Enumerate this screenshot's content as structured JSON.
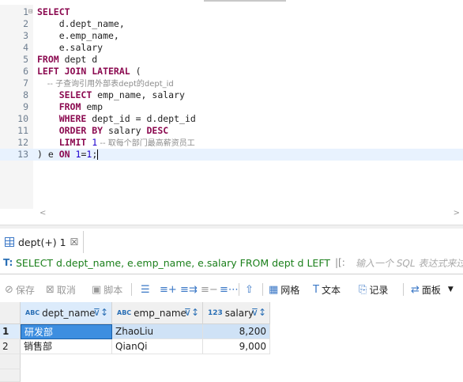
{
  "editor": {
    "lines": [
      {
        "n": "1",
        "parts": [
          {
            "t": "SELECT",
            "c": "kw"
          }
        ]
      },
      {
        "n": "2",
        "parts": [
          {
            "t": "    d.dept_name,",
            "c": "pl"
          }
        ]
      },
      {
        "n": "3",
        "parts": [
          {
            "t": "    e.emp_name,",
            "c": "pl"
          }
        ]
      },
      {
        "n": "4",
        "parts": [
          {
            "t": "    e.salary",
            "c": "pl"
          }
        ]
      },
      {
        "n": "5",
        "parts": [
          {
            "t": "FROM",
            "c": "kw"
          },
          {
            "t": " dept d",
            "c": "pl"
          }
        ]
      },
      {
        "n": "6",
        "parts": [
          {
            "t": "LEFT JOIN LATERAL",
            "c": "kw"
          },
          {
            "t": " (",
            "c": "pl"
          }
        ]
      },
      {
        "n": "7",
        "parts": [
          {
            "t": "    -- 子查询引用外部表dept的dept_id",
            "c": "cm"
          }
        ]
      },
      {
        "n": "8",
        "parts": [
          {
            "t": "    ",
            "c": "pl"
          },
          {
            "t": "SELECT",
            "c": "kw"
          },
          {
            "t": " emp_name, salary",
            "c": "pl"
          }
        ]
      },
      {
        "n": "9",
        "parts": [
          {
            "t": "    ",
            "c": "pl"
          },
          {
            "t": "FROM",
            "c": "kw"
          },
          {
            "t": " emp",
            "c": "pl"
          }
        ]
      },
      {
        "n": "10",
        "parts": [
          {
            "t": "    ",
            "c": "pl"
          },
          {
            "t": "WHERE",
            "c": "kw"
          },
          {
            "t": " dept_id = d.dept_id",
            "c": "pl"
          }
        ]
      },
      {
        "n": "11",
        "parts": [
          {
            "t": "    ",
            "c": "pl"
          },
          {
            "t": "ORDER BY",
            "c": "kw"
          },
          {
            "t": " salary ",
            "c": "pl"
          },
          {
            "t": "DESC",
            "c": "kw"
          }
        ]
      },
      {
        "n": "12",
        "parts": [
          {
            "t": "    ",
            "c": "pl"
          },
          {
            "t": "LIMIT",
            "c": "kw"
          },
          {
            "t": " ",
            "c": "pl"
          },
          {
            "t": "1",
            "c": "num"
          },
          {
            "t": " -- 取每个部门最高薪资员工",
            "c": "cm"
          }
        ]
      },
      {
        "n": "13",
        "parts": [
          {
            "t": ") e ",
            "c": "pl"
          },
          {
            "t": "ON",
            "c": "kw"
          },
          {
            "t": " ",
            "c": "pl"
          },
          {
            "t": "1",
            "c": "num"
          },
          {
            "t": "=",
            "c": "pl"
          },
          {
            "t": "1",
            "c": "num"
          },
          {
            "t": ";",
            "c": "pl"
          }
        ]
      }
    ],
    "current_line": 13
  },
  "results_tab": {
    "label": "dept(+) 1",
    "close": "☒"
  },
  "filter": {
    "query": "SELECT d.dept_name, e.emp_name, e.salary FROM dept d LEFT JOIN",
    "placeholder": "输入一个 SQL 表达式来过滤"
  },
  "toolbar": {
    "save": "保存",
    "cancel": "取消",
    "script": "脚本",
    "grid": "网格",
    "text": "文本",
    "record": "记录",
    "panel": "面板"
  },
  "table": {
    "columns": [
      {
        "type": "ABC",
        "name": "dept_name"
      },
      {
        "type": "ABC",
        "name": "emp_name"
      },
      {
        "type": "123",
        "name": "salary"
      }
    ],
    "rows": [
      {
        "n": "1",
        "dept_name": "研发部",
        "emp_name": "ZhaoLiu",
        "salary": "8,200"
      },
      {
        "n": "2",
        "dept_name": "销售部",
        "emp_name": "QianQi",
        "salary": "9,000"
      }
    ]
  },
  "colors": {
    "keyword": "#8b0a50",
    "number": "#1c00cf",
    "comment": "#8c8c8c",
    "selection": "#3d8ee0"
  }
}
